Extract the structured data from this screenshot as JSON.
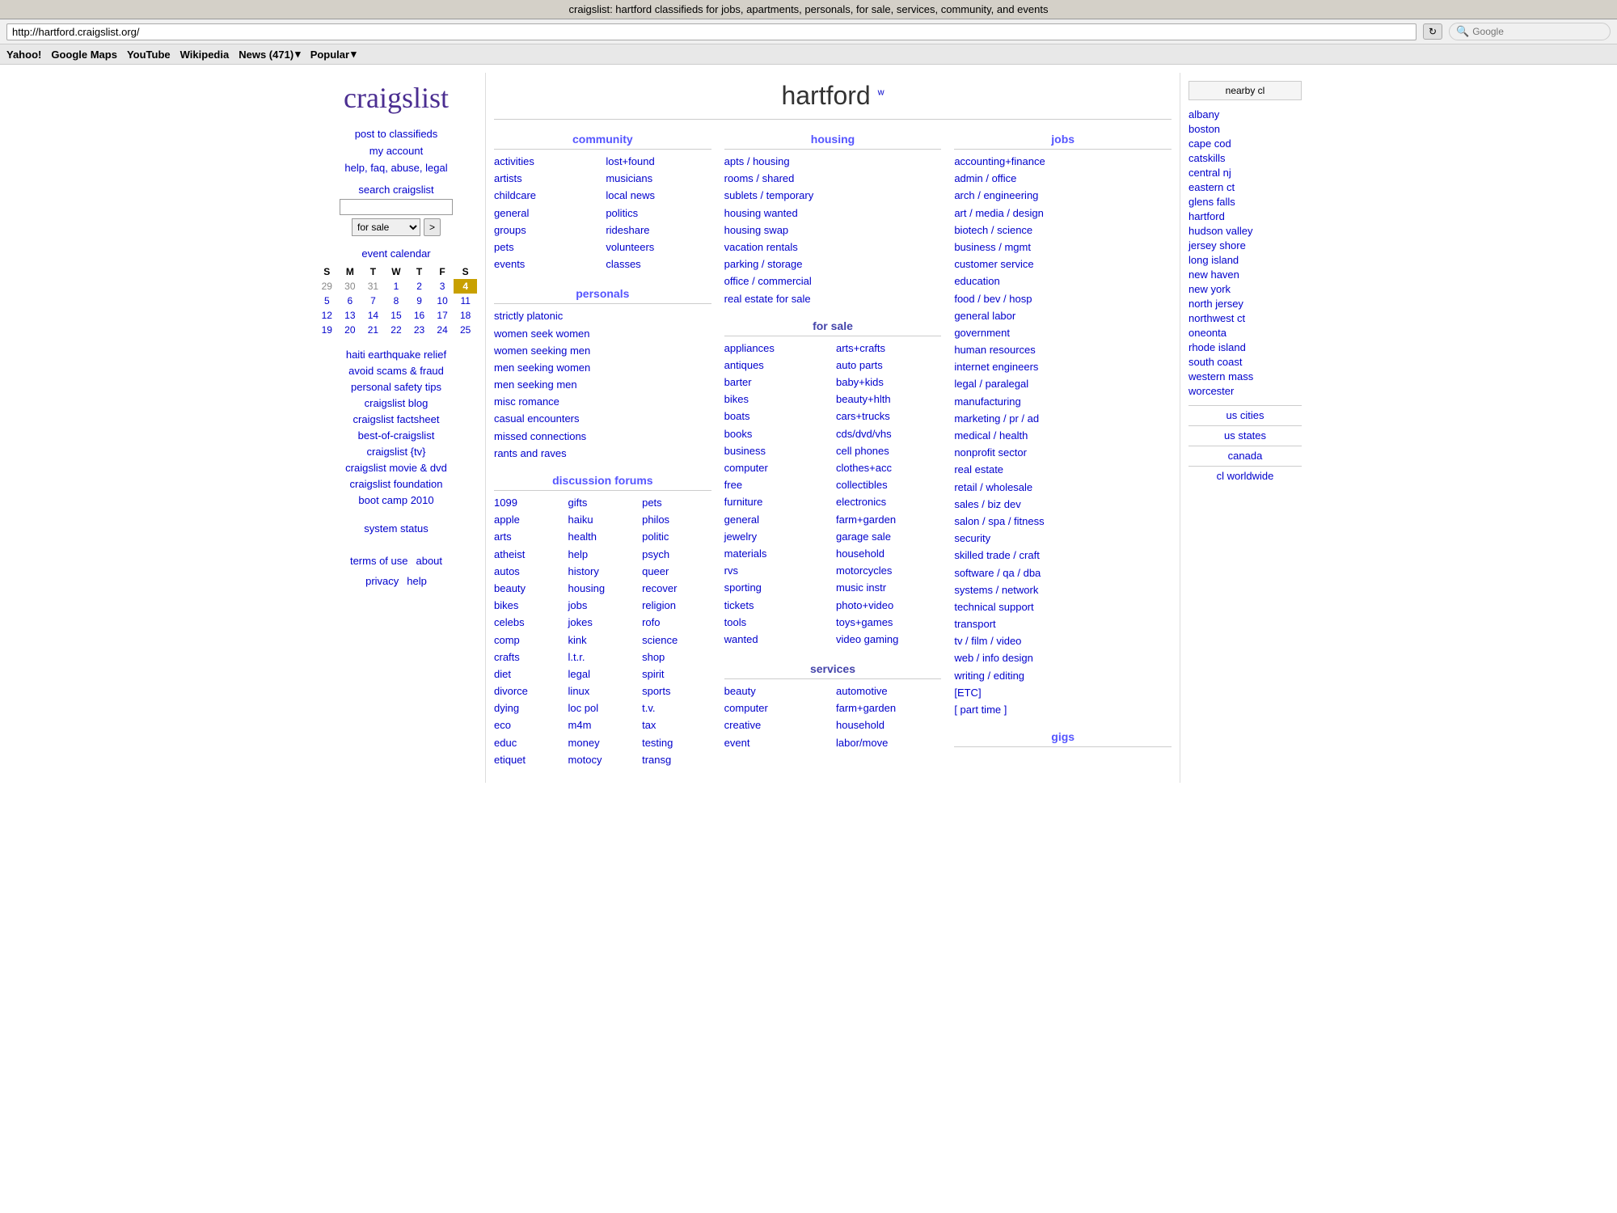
{
  "browser": {
    "title": "craigslist: hartford classifieds for jobs, apartments, personals, for sale, services, community, and events",
    "address": "http://hartford.craigslist.org/",
    "refresh_label": "↻",
    "search_placeholder": "Google",
    "bookmarks": [
      "Yahoo!",
      "Google Maps",
      "YouTube",
      "Wikipedia"
    ],
    "news_label": "News (471)",
    "popular_label": "Popular"
  },
  "sidebar": {
    "logo": "craigslist",
    "post_label": "post to classifieds",
    "account_label": "my account",
    "help_label": "help, faq, abuse, legal",
    "search_label": "search craigslist",
    "search_placeholder": "for sale",
    "calendar_title": "event calendar",
    "calendar_days": [
      "S",
      "M",
      "T",
      "W",
      "T",
      "F",
      "S"
    ],
    "calendar_weeks": [
      [
        "29",
        "30",
        "31",
        "1",
        "2",
        "3",
        "4"
      ],
      [
        "5",
        "6",
        "7",
        "8",
        "9",
        "10",
        "11"
      ],
      [
        "12",
        "13",
        "14",
        "15",
        "16",
        "17",
        "18"
      ],
      [
        "19",
        "20",
        "21",
        "22",
        "23",
        "24",
        "25"
      ]
    ],
    "today": "4",
    "other_month_days": [
      "29",
      "30",
      "31"
    ],
    "haiti_label": "haiti earthquake relief",
    "avoid_label": "avoid scams & fraud",
    "safety_label": "personal safety tips",
    "blog_label": "craigslist blog",
    "factsheet_label": "craigslist factsheet",
    "best_label": "best-of-craigslist",
    "tv_label": "craigslist {tv}",
    "movie_label": "craigslist movie & dvd",
    "foundation_label": "craigslist foundation",
    "bootcamp_label": "boot camp 2010",
    "system_label": "system status",
    "terms_label": "terms of use",
    "about_label": "about",
    "privacy_label": "privacy",
    "help2_label": "help"
  },
  "main": {
    "city": "hartford",
    "w_link": "w",
    "community": {
      "title": "community",
      "col1": [
        "activities",
        "artists",
        "childcare",
        "general",
        "groups",
        "pets",
        "events"
      ],
      "col2": [
        "lost+found",
        "musicians",
        "local news",
        "politics",
        "rideshare",
        "volunteers",
        "classes"
      ]
    },
    "personals": {
      "title": "personals",
      "items": [
        "strictly platonic",
        "women seek women",
        "women seeking men",
        "men seeking women",
        "men seeking men",
        "misc romance",
        "casual encounters",
        "missed connections",
        "rants and raves"
      ]
    },
    "discussion": {
      "title": "discussion forums",
      "col1": [
        "1099",
        "apple",
        "arts",
        "atheist",
        "autos",
        "beauty",
        "bikes",
        "celebs",
        "comp",
        "crafts",
        "diet",
        "divorce",
        "dying",
        "eco",
        "educ",
        "etiquet"
      ],
      "col2": [
        "gifts",
        "haiku",
        "health",
        "help",
        "history",
        "housing",
        "jobs",
        "jokes",
        "kink",
        "l.t.r.",
        "legal",
        "linux",
        "loc pol",
        "m4m",
        "money",
        "motocy"
      ],
      "col3": [
        "pets",
        "philos",
        "politic",
        "psych",
        "queer",
        "recover",
        "religion",
        "rofo",
        "science",
        "shop",
        "spirit",
        "sports",
        "t.v.",
        "tax",
        "testing",
        "transg"
      ]
    },
    "housing": {
      "title": "housing",
      "items": [
        "apts / housing",
        "rooms / shared",
        "sublets / temporary",
        "housing wanted",
        "housing swap",
        "vacation rentals",
        "parking / storage",
        "office / commercial",
        "real estate for sale"
      ]
    },
    "for_sale": {
      "title": "for sale",
      "col1": [
        "appliances",
        "antiques",
        "barter",
        "bikes",
        "boats",
        "books",
        "business",
        "computer",
        "free",
        "furniture",
        "general",
        "jewelry",
        "materials",
        "rvs",
        "sporting",
        "tickets",
        "tools",
        "wanted"
      ],
      "col2": [
        "arts+crafts",
        "auto parts",
        "baby+kids",
        "beauty+hlth",
        "cars+trucks",
        "cds/dvd/vhs",
        "cell phones",
        "clothes+acc",
        "collectibles",
        "electronics",
        "farm+garden",
        "garage sale",
        "household",
        "motorcycles",
        "music instr",
        "photo+video",
        "toys+games",
        "video gaming"
      ]
    },
    "services": {
      "title": "services",
      "col1": [
        "beauty",
        "computer",
        "creative",
        "event"
      ],
      "col2": [
        "automotive",
        "farm+garden",
        "household",
        "labor/move"
      ]
    },
    "jobs": {
      "title": "jobs",
      "items": [
        "accounting+finance",
        "admin / office",
        "arch / engineering",
        "art / media / design",
        "biotech / science",
        "business / mgmt",
        "customer service",
        "education",
        "food / bev / hosp",
        "general labor",
        "government",
        "human resources",
        "internet engineers",
        "legal / paralegal",
        "manufacturing",
        "marketing / pr / ad",
        "medical / health",
        "nonprofit sector",
        "real estate",
        "retail / wholesale",
        "sales / biz dev",
        "salon / spa / fitness",
        "security",
        "skilled trade / craft",
        "software / qa / dba",
        "systems / network",
        "technical support",
        "transport",
        "tv / film / video",
        "web / info design",
        "writing / editing",
        "[ETC]",
        "[ part time ]"
      ]
    },
    "gigs": {
      "title": "gigs"
    }
  },
  "nearby": {
    "title": "nearby cl",
    "cities": [
      "albany",
      "boston",
      "cape cod",
      "catskills",
      "central nj",
      "eastern ct",
      "glens falls",
      "hartford",
      "hudson valley",
      "jersey shore",
      "long island",
      "new haven",
      "new york",
      "north jersey",
      "northwest ct",
      "oneonta",
      "rhode island",
      "south coast",
      "western mass",
      "worcester"
    ],
    "us_cities": "us cities",
    "us_states": "us states",
    "canada": "canada",
    "cl_worldwide": "cl worldwide"
  }
}
